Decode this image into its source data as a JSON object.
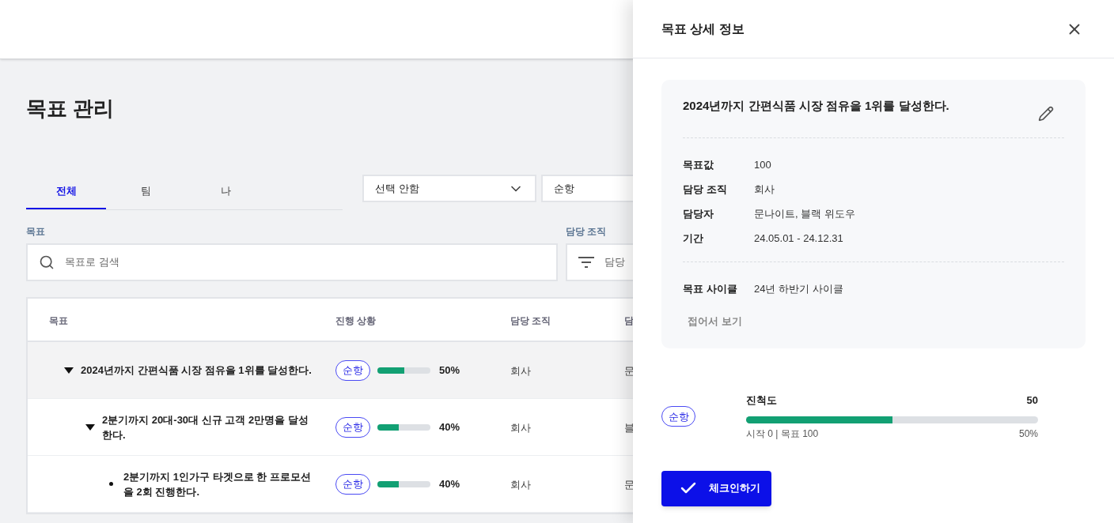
{
  "page": {
    "title": "목표 관리"
  },
  "tabs": [
    {
      "label": "전체",
      "selected": true
    },
    {
      "label": "팀",
      "selected": false
    },
    {
      "label": "나",
      "selected": false
    }
  ],
  "selects": [
    "선택 안함",
    "순항"
  ],
  "filters": {
    "goal_label": "목표",
    "search_placeholder": "목표로 검색",
    "org_label": "담당 조직",
    "org_placeholder": "담당"
  },
  "table": {
    "columns": [
      "목표",
      "진행 상황",
      "담당 조직",
      "담"
    ],
    "rows": [
      {
        "title": "2024년까지 간편식품 시장 점유을 1위를 달성한다.",
        "status": "순항",
        "level": 0.5,
        "percent": "50%",
        "org": "회사",
        "column_4": "문",
        "selected": true,
        "expanded": true,
        "children": [
          {
            "title": "2분기까지 20대-30대 신규 고객 2만명을 달성한다.",
            "status": "순항",
            "level": 0.4,
            "percent": "40%",
            "org": "회사",
            "column_4": "블",
            "selected": false,
            "expanded": true,
            "children": [
              {
                "title": "2분기까지 1인가구 타겟으로 한 프로모션을 2회 진행한다.",
                "status": "순항",
                "level": 0.4,
                "percent": "40%",
                "org": "회사",
                "column_4": "문",
                "selected": false
              }
            ]
          }
        ]
      }
    ]
  },
  "drawer": {
    "title": "목표 상세 정보",
    "goal_title": "2024년까지 간편식품 시장 점유을 1위를 달성한다.",
    "details": [
      {
        "label": "목표값",
        "value": "100"
      },
      {
        "label": "담당 조직",
        "value": "회사"
      },
      {
        "label": "담당자",
        "value": "문나이트, 블랙 위도우"
      },
      {
        "label": "기간",
        "value": "24.05.01 - 24.12.31"
      }
    ],
    "cycle": {
      "label": "목표 사이클",
      "value": "24년 하반기 사이클"
    },
    "collapse_link": "접어서 보기",
    "progress": {
      "status": "순항",
      "label": "진척도",
      "value": "50",
      "level": 0.5,
      "range": "시작 0 | 목표 100",
      "percent": "50%"
    },
    "checkin_button": "체크인하기"
  }
}
